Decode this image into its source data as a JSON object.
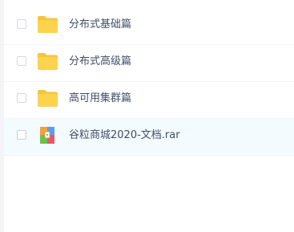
{
  "files": [
    {
      "name": "分布式基础篇",
      "ext": "",
      "type": "folder",
      "icon": "folder-icon"
    },
    {
      "name": "分布式高级篇",
      "ext": "",
      "type": "folder",
      "icon": "folder-icon"
    },
    {
      "name": "高可用集群篇",
      "ext": "",
      "type": "folder",
      "icon": "folder-icon"
    },
    {
      "name": "谷粒商城2020-文档",
      "ext": ".rar",
      "type": "archive",
      "icon": "archive-icon"
    }
  ],
  "colors": {
    "folder": "#fcd34d",
    "folder_tab": "#f8c53a",
    "row_hover": "#f4fbff",
    "text": "#424e67"
  }
}
